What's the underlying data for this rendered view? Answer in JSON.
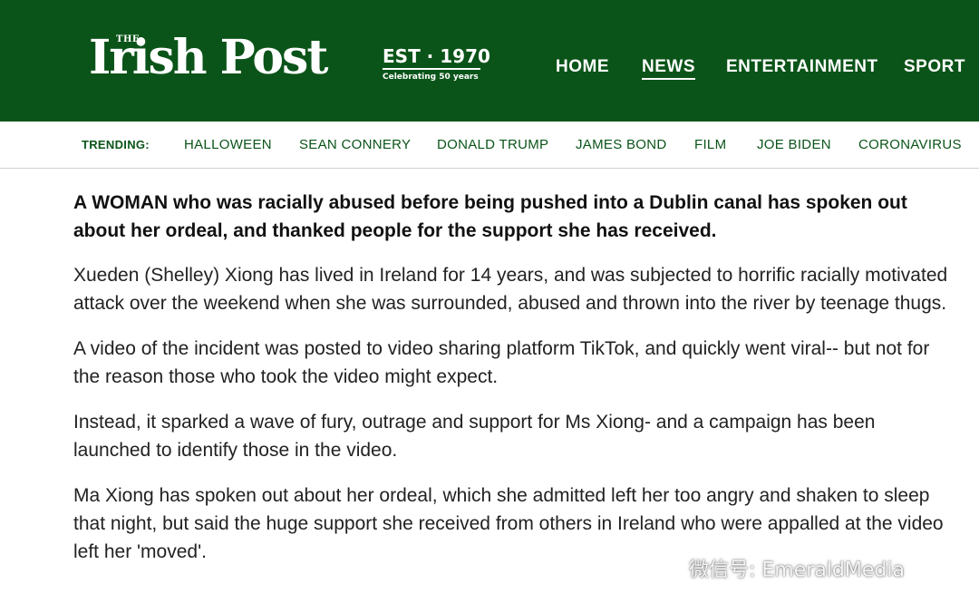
{
  "header": {
    "logo_the": "THE",
    "logo_name": "Irish Post",
    "est": "EST · 1970",
    "celebrating": "Celebrating 50 years",
    "brand_color": "#0b5419",
    "nav": [
      {
        "label": "HOME",
        "active": false
      },
      {
        "label": "NEWS",
        "active": true
      },
      {
        "label": "ENTERTAINMENT",
        "active": false
      },
      {
        "label": "SPORT",
        "active": false
      }
    ]
  },
  "trending": {
    "label": "TRENDING:",
    "items": [
      "HALLOWEEN",
      "SEAN CONNERY",
      "DONALD TRUMP",
      "JAMES BOND",
      "FILM",
      "JOE BIDEN",
      "CORONAVIRUS"
    ]
  },
  "article": {
    "lead": "A WOMAN who was racially abused before being pushed into a Dublin canal has spoken out about her ordeal, and thanked people for the support she has received.",
    "paragraphs": [
      "Xueden (Shelley) Xiong has lived in Ireland for 14 years, and was subjected to  horrific racially motivated attack over the weekend when she was surrounded, abused and thrown into the river by teenage thugs.",
      "A video of the incident was posted to video sharing platform TikTok, and quickly went viral-- but not for the reason those who took the video might expect.",
      "Instead, it sparked a wave of fury, outrage and support for Ms Xiong- and a campaign has been launched to identify those in the video.",
      "Ma Xiong has spoken out about her ordeal, which she admitted left her too angry and shaken to sleep that night, but said the huge support she received from others in Ireland who were appalled at the video left her 'moved'."
    ]
  },
  "watermark": {
    "text": "微信号: EmeraldMedia",
    "icon": "wechat-icon"
  }
}
